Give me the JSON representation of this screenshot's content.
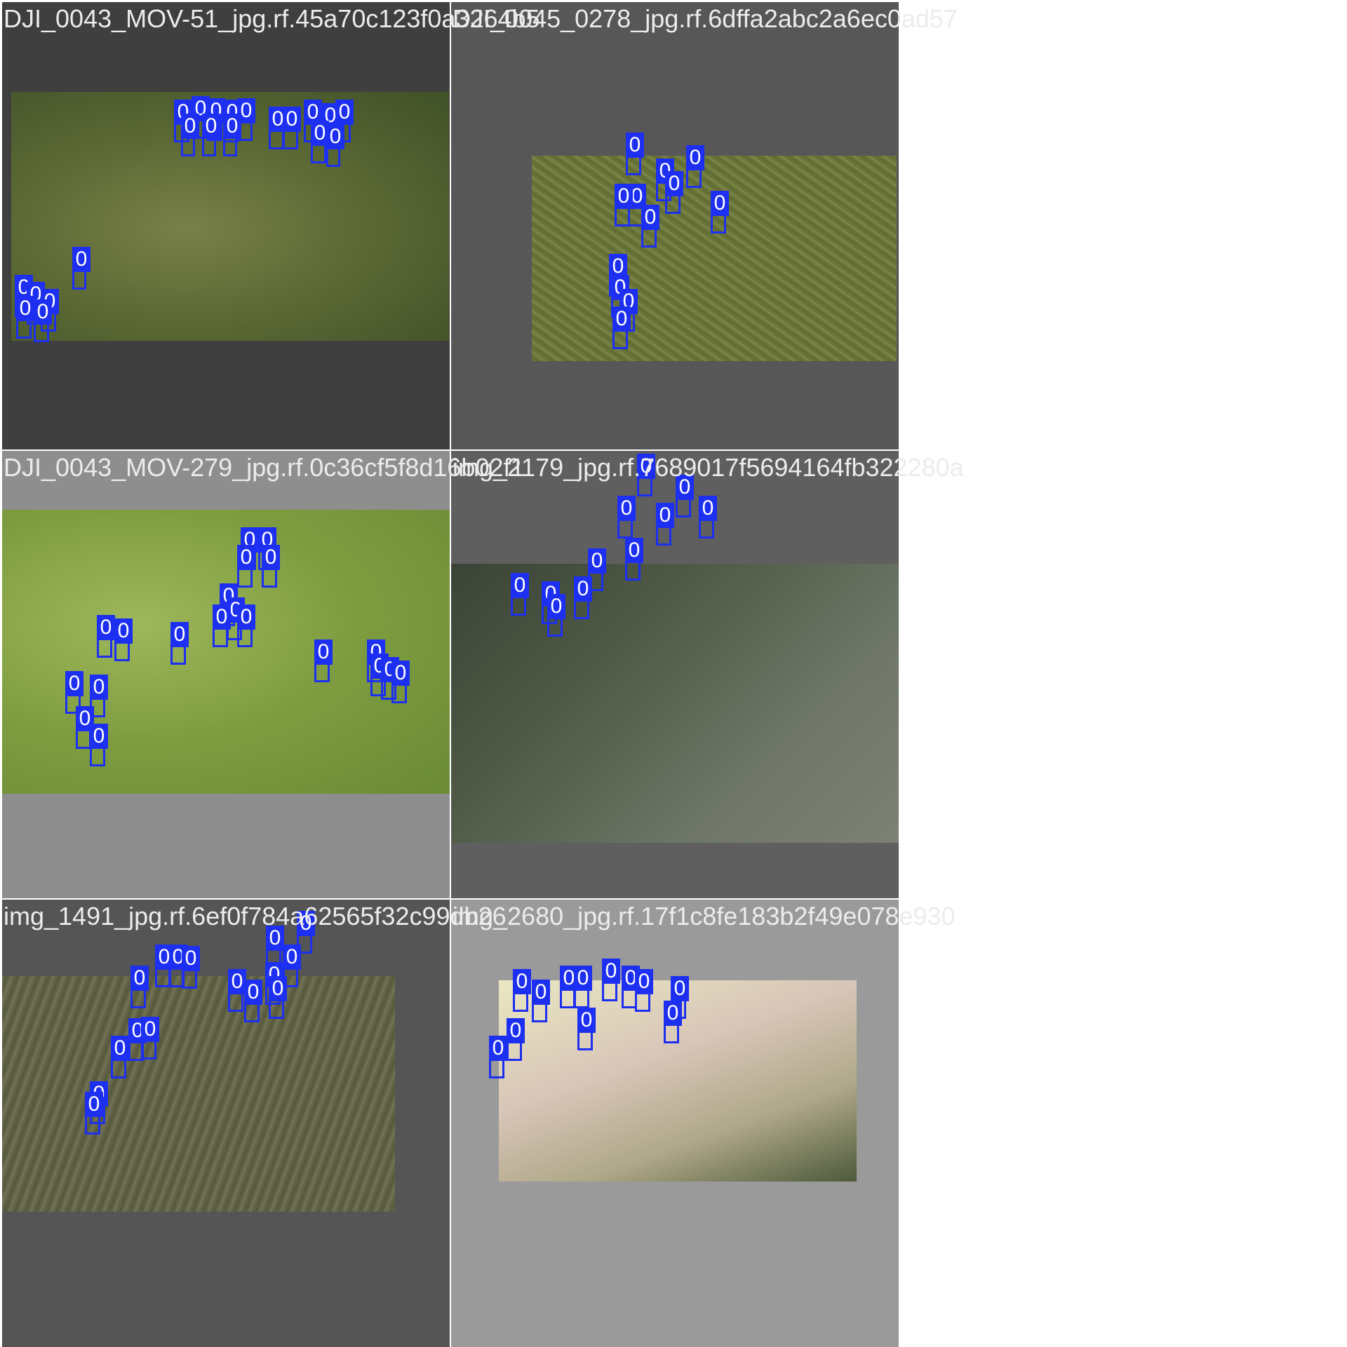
{
  "tiles": [
    {
      "title": "DJI_0043_MOV-51_jpg.rf.45a70c123f0a3264b5",
      "label": "0",
      "background": "#3f3f3f"
    },
    {
      "title": "DJI_0045_0278_jpg.rf.6dffa2abc2a6ec0ad57",
      "label": "0",
      "background": "#575757"
    },
    {
      "title": "DJI_0043_MOV-279_jpg.rf.0c36cf5f8d16b02f1",
      "label": "0",
      "background": "#8e8e8e"
    },
    {
      "title": "img_2179_jpg.rf.7689017f5694164fb322280a",
      "label": "0",
      "background": "#5f5f5f"
    },
    {
      "title": "img_1491_jpg.rf.6ef0f784a62565f32c99db26",
      "label": "0",
      "background": "#555555"
    },
    {
      "title": "img_2680_jpg.rf.17f1c8fe183b2f49e078e930",
      "label": "0",
      "background": "#9a9a9a"
    }
  ],
  "box_color": "#1d2ff0"
}
